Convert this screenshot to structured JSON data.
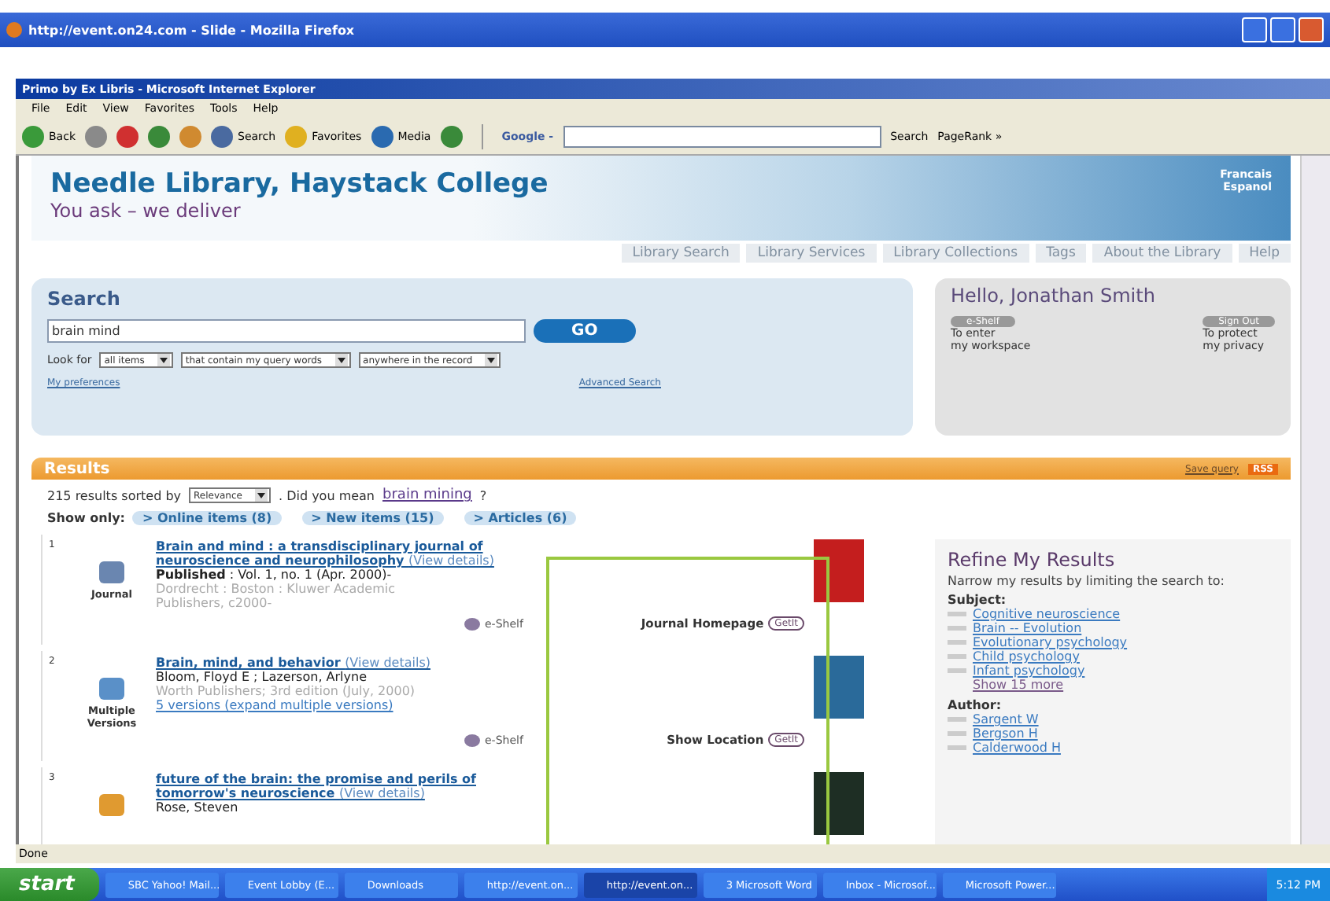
{
  "browser": {
    "title": "http://event.on24.com - Slide - Mozilla Firefox"
  },
  "ie": {
    "title": "Primo by Ex Libris - Microsoft Internet Explorer",
    "menu": [
      "File",
      "Edit",
      "View",
      "Favorites",
      "Tools",
      "Help"
    ],
    "toolbar": [
      {
        "kind": "back",
        "label": "Back"
      },
      {
        "kind": "forward"
      },
      {
        "kind": "stop"
      },
      {
        "kind": "refresh"
      },
      {
        "kind": "home"
      },
      {
        "kind": "search",
        "label": "Search"
      },
      {
        "kind": "favorites",
        "label": "Favorites"
      },
      {
        "kind": "media",
        "label": "Media"
      },
      {
        "kind": "history"
      }
    ],
    "google_label": "Google -",
    "google_search": "Search",
    "pagerank": "PageRank »",
    "status": "Done"
  },
  "header": {
    "title": "Needle Library, Haystack College",
    "tagline": "You ask – we deliver",
    "languages": [
      "Francais",
      "Espanol"
    ]
  },
  "nav": [
    "Library Search",
    "Library Services",
    "Library Collections",
    "Tags",
    "About the Library",
    "Help"
  ],
  "search": {
    "heading": "Search",
    "query": "brain mind",
    "go": "GO",
    "look_for": "Look for",
    "selects": [
      "all items",
      "that contain my query words",
      "anywhere in the record"
    ],
    "preferences": "My preferences",
    "advanced": "Advanced Search"
  },
  "user": {
    "greeting": "Hello, Jonathan Smith",
    "actions": [
      {
        "button": "e-Shelf",
        "lines": [
          "To enter",
          "my workspace"
        ]
      },
      {
        "button": "Sign Out",
        "lines": [
          "To protect",
          "my privacy"
        ]
      }
    ]
  },
  "results": {
    "heading": "Results",
    "save_query": "Save query",
    "rss": "RSS",
    "count_text": "215 results sorted by",
    "sort": "Relevance",
    "did_you_mean": ". Did you mean",
    "suggestion": "brain mining",
    "suggestion_end": "?",
    "show_only": "Show only:",
    "filters": [
      "> Online items (8)",
      "> New items (15)",
      "> Articles (6)"
    ],
    "items": [
      {
        "number": "1",
        "kind": "journal",
        "type_label": "Journal",
        "title": "Brain and mind : a transdisciplinary journal of neuroscience and neurophilosophy",
        "view": "(View details)",
        "lines": [
          {
            "kind": "dark",
            "text": "**Published** : Vol. 1, no. 1 (Apr. 2000)-"
          },
          {
            "kind": "muted",
            "text": "Dordrecht : Boston : Kluwer Academic Publishers, c2000-"
          }
        ],
        "eshelf": "e-Shelf",
        "action": {
          "label": "Journal Homepage",
          "button": "GetIt"
        },
        "color": "#c41e1e"
      },
      {
        "number": "2",
        "kind": "versions",
        "type_label": "Multiple Versions",
        "title": "Brain, mind, and behavior",
        "view": "(View details)",
        "lines": [
          {
            "kind": "dark",
            "text": "Bloom, Floyd E ; Lazerson, Arlyne"
          },
          {
            "kind": "muted",
            "text": "Worth Publishers; 3rd edition (July, 2000)"
          },
          {
            "kind": "link",
            "text": "5 versions (expand multiple versions)"
          }
        ],
        "eshelf": "e-Shelf",
        "action": {
          "label": "Show Location",
          "button": "GetIt"
        },
        "color": "#2a6a9a"
      },
      {
        "number": "3",
        "kind": "book",
        "title": "future of the brain: the promise and perils of tomorrow's neuroscience",
        "view": "(View details)",
        "lines": [
          {
            "kind": "dark",
            "text": "Rose, Steven"
          }
        ],
        "color": "#1e2e24"
      }
    ]
  },
  "refine": {
    "heading": "Refine My Results",
    "intro": "Narrow my results by limiting the search to:",
    "groups": [
      {
        "label": "Subject:",
        "links": [
          "Cognitive neuroscience",
          "Brain -- Evolution",
          "Evolutionary psychology",
          "Child psychology",
          "Infant psychology"
        ],
        "more": "Show 15 more"
      },
      {
        "label": "Author:",
        "links": [
          "Sargent W",
          "Bergson H",
          "Calderwood H"
        ]
      }
    ]
  },
  "taskbar": {
    "start": "start",
    "items": [
      {
        "label": "SBC Yahoo! Mail...",
        "selected": false
      },
      {
        "label": "Event Lobby (E...",
        "selected": false
      },
      {
        "label": "Downloads",
        "selected": false
      },
      {
        "label": "http://event.on...",
        "selected": false
      },
      {
        "label": "http://event.on...",
        "selected": true
      },
      {
        "label": "3 Microsoft Word",
        "selected": false
      },
      {
        "label": "Inbox - Microsof...",
        "selected": false
      },
      {
        "label": "Microsoft Power...",
        "selected": false
      }
    ],
    "time": "5:12 PM"
  }
}
